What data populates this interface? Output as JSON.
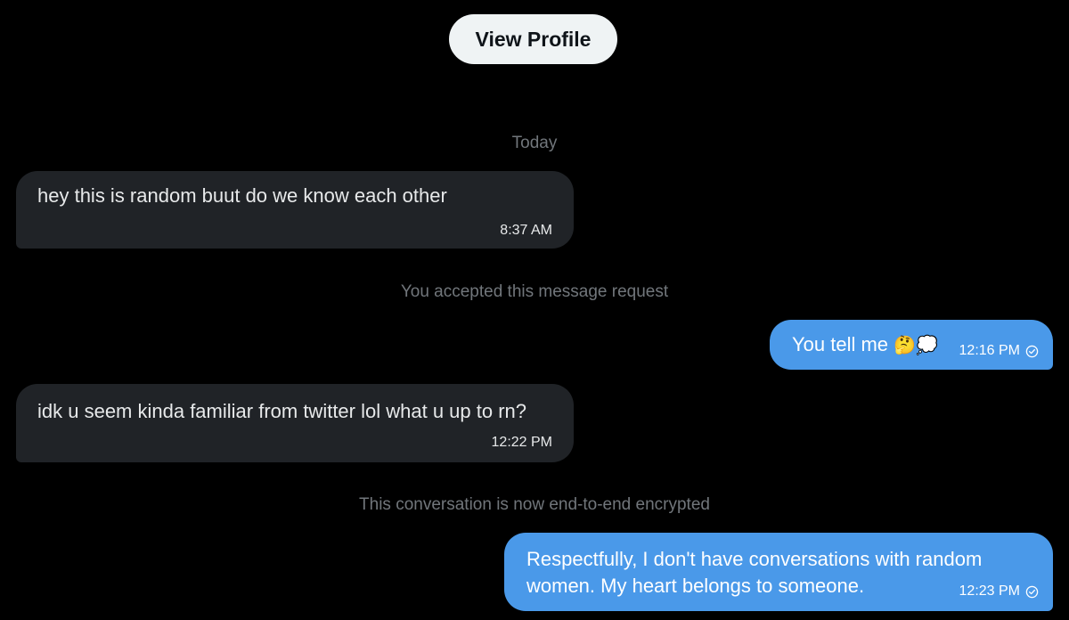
{
  "header": {
    "view_profile_label": "View Profile"
  },
  "separators": {
    "date": "Today",
    "accepted": "You accepted this message request",
    "encrypted": "This conversation is now end-to-end encrypted"
  },
  "messages": [
    {
      "direction": "received",
      "text": "hey this is random buut do we know each other",
      "time": "8:37 AM"
    },
    {
      "direction": "sent",
      "text": "You tell me",
      "emoji": "🤔💭",
      "time": "12:16 PM",
      "status_icon": "check-circle-icon"
    },
    {
      "direction": "received",
      "text": "idk u seem kinda familiar from twitter lol what u up to rn?",
      "time": "12:22 PM"
    },
    {
      "direction": "sent",
      "text": "Respectfully, I don't have conversations with random women. My heart belongs to someone.",
      "time": "12:23 PM",
      "status_icon": "check-circle-icon"
    }
  ],
  "colors": {
    "background": "#000000",
    "received_bubble": "#202327",
    "sent_bubble": "#4a99e9",
    "system_text": "#71767b",
    "button_bg": "#eff3f4"
  }
}
